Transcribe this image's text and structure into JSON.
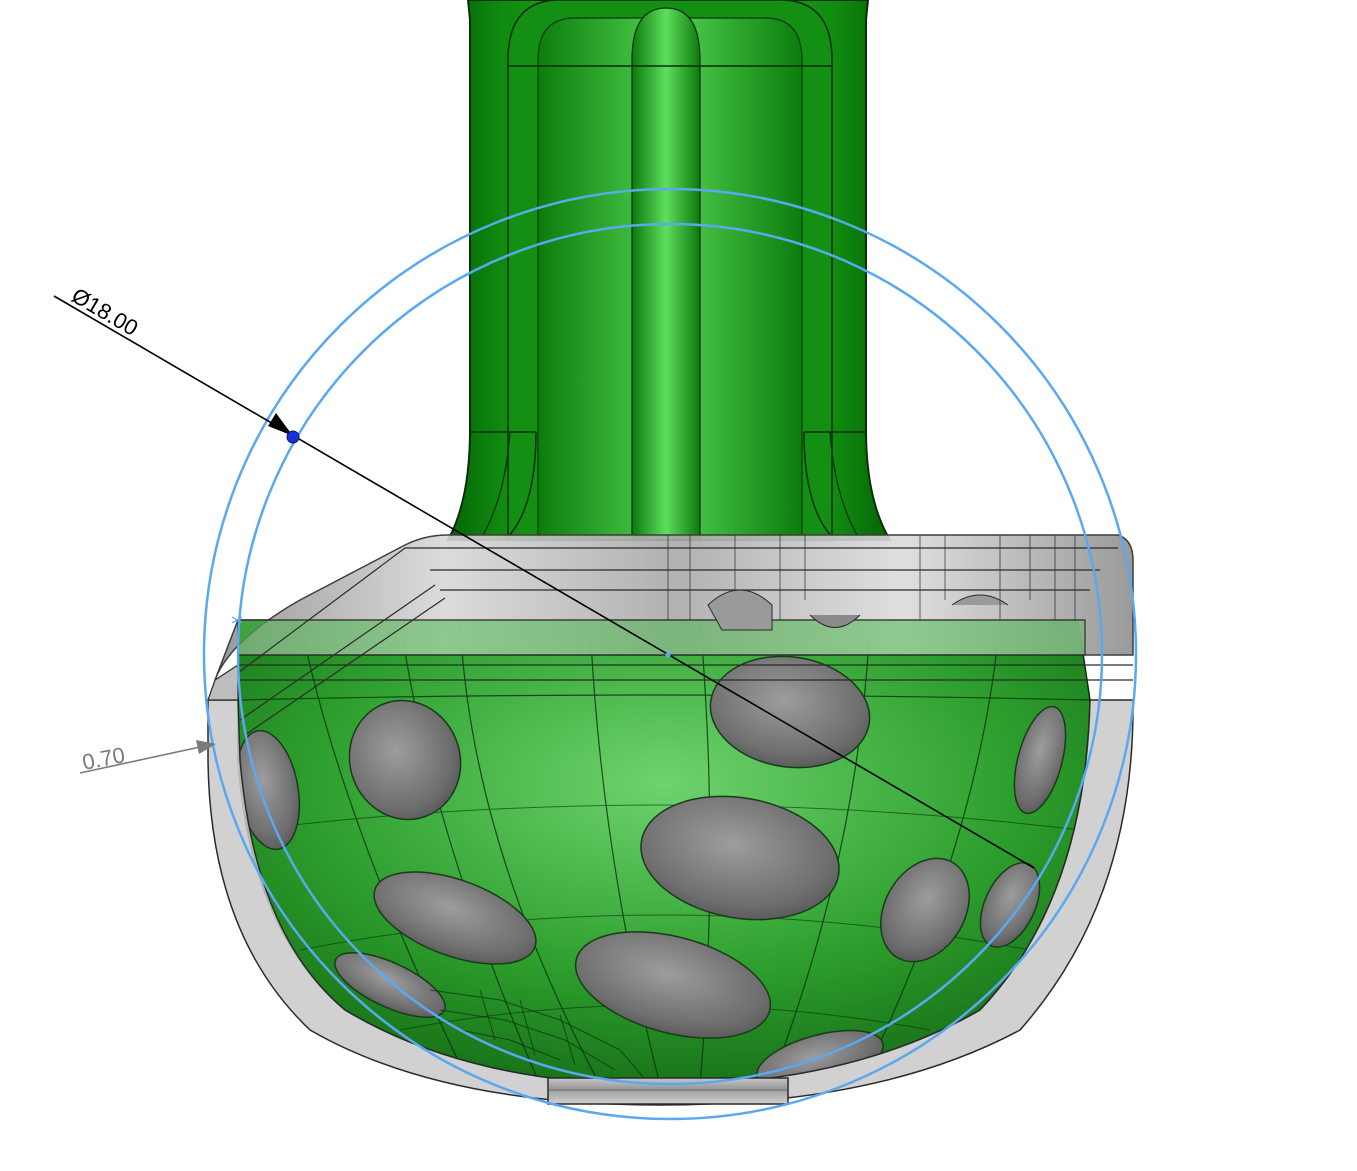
{
  "viewport": {
    "background": "#ffffff",
    "part_color": "#1f9a1f",
    "part_dark": "#0a6e0a",
    "shell_color": "#b9b9b9",
    "sketch_color": "#5aa9f0",
    "dimension_color": "#000000"
  },
  "dimensions": {
    "diameter": {
      "label": "Ø18.00",
      "value": 18.0,
      "handle_color": "#1a2fd6"
    },
    "thickness": {
      "label": "0.70",
      "value": 0.7,
      "color": "#7a7a7a"
    }
  }
}
